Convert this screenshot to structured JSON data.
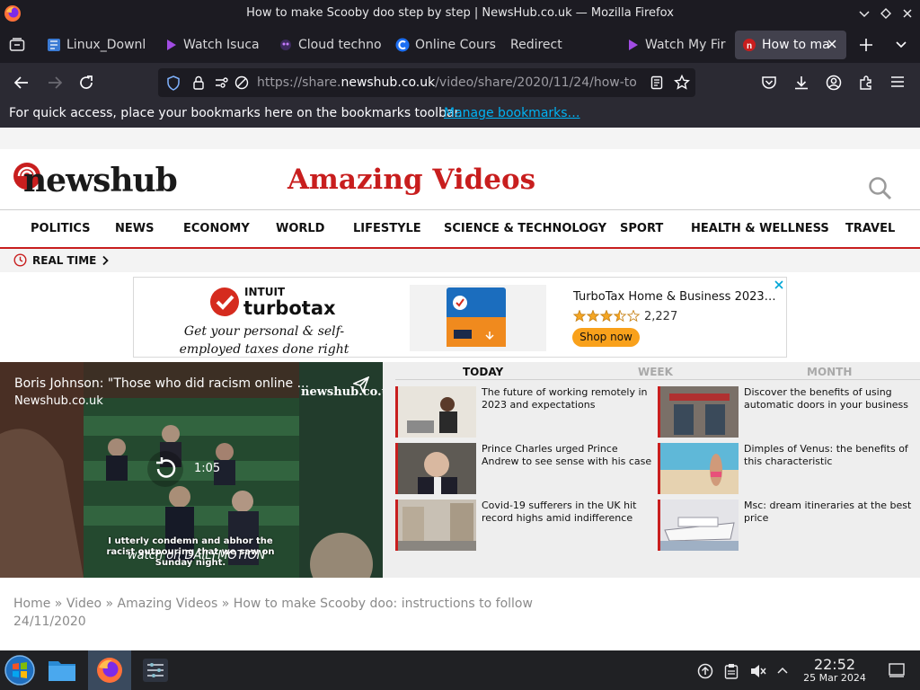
{
  "window": {
    "title": "How to make Scooby doo step by step | NewsHub.co.uk — Mozilla Firefox"
  },
  "tabs": [
    {
      "label": "Linux_Downl",
      "icon": "document-icon"
    },
    {
      "label": "Watch Isuca",
      "icon": "play-icon"
    },
    {
      "label": "Cloud techno",
      "icon": "cloud-icon"
    },
    {
      "label": "Online Cours",
      "icon": "c-logo-icon"
    },
    {
      "label": "Redirect",
      "icon": "none"
    },
    {
      "label": "Watch My Fir",
      "icon": "play-icon"
    },
    {
      "label": "How to ma",
      "icon": "newshub-icon",
      "active": true
    }
  ],
  "urlbar": {
    "url_prefix": "https://share.",
    "url_domain": "newshub.co.uk",
    "url_rest": "/video/share/2020/11/24/how-to"
  },
  "bookmarks_bar": {
    "message": "For quick access, place your bookmarks here on the bookmarks toolbar.",
    "link": "Manage bookmarks…"
  },
  "site": {
    "logo": "newshub",
    "section_title": "Amazing Videos",
    "nav": [
      "POLITICS",
      "NEWS",
      "ECONOMY",
      "WORLD",
      "LIFESTYLE",
      "SCIENCE & TECHNOLOGY",
      "SPORT",
      "HEALTH & WELLNESS",
      "TRAVEL"
    ],
    "realtime": "REAL TIME"
  },
  "ad": {
    "brand_top": "INTUIT",
    "brand": "turbotax",
    "tagline": "Get your personal & self-employed taxes done right",
    "product": "TurboTax Home & Business 2023…",
    "rating_count": "2,227",
    "rating_stars": 3.5,
    "cta": "Shop now"
  },
  "video": {
    "title": "Boris Johnson: \"Those who did racism online ...",
    "source": "Newshub.co.uk",
    "watermark": "newshub.co.uk",
    "duration": "1:05",
    "caption": "I utterly condemn and abhor the racist outpouring that we saw on Sunday night.",
    "watch_on": "watch on DAILYMOTION"
  },
  "trending": {
    "tabs": [
      "TODAY",
      "WEEK",
      "MONTH"
    ],
    "active_tab": "TODAY",
    "stories": [
      {
        "text": "The future of working remotely in 2023 and expectations"
      },
      {
        "text": "Discover the benefits of using automatic doors in your business"
      },
      {
        "text": "Prince Charles urged Prince Andrew to see sense with his case"
      },
      {
        "text": "Dimples of Venus: the benefits of this characteristic"
      },
      {
        "text": "Covid-19 sufferers in the UK hit record highs amid indifference"
      },
      {
        "text": "Msc: dream itineraries at the best price"
      }
    ]
  },
  "breadcrumb": {
    "items": [
      "Home",
      "Video",
      "Amazing Videos",
      "How to make Scooby doo: instructions to follow"
    ],
    "separator": "»",
    "date": "24/11/2020"
  },
  "taskbar": {
    "time": "22:52",
    "date": "25 Mar 2024"
  },
  "colors": {
    "brand_red": "#c81e1e",
    "firefox_dark": "#1c1b22",
    "toolbar": "#2b2a33",
    "link_blue": "#00b3f4"
  }
}
